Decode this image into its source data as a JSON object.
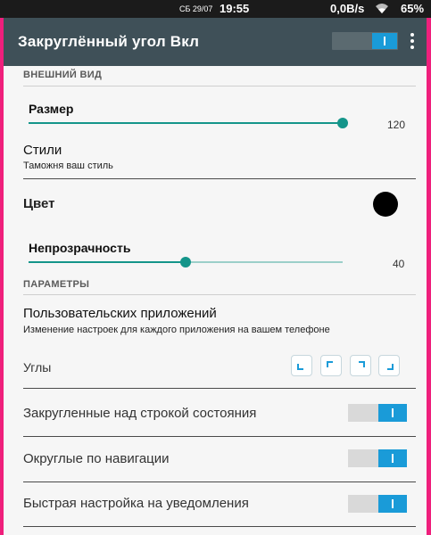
{
  "status_bar": {
    "date": "СБ 29/07",
    "time": "19:55",
    "network_speed": "0,0B/s",
    "battery": "65"
  },
  "toolbar": {
    "title": "Закруглённый угол Вкл",
    "main_switch_on": true
  },
  "appearance": {
    "header": "ВНЕШНИЙ ВИД",
    "size": {
      "label": "Размер",
      "value": "120",
      "fraction": 0.99
    },
    "styles": {
      "title": "Стили",
      "summary": "Таможня ваш стиль"
    },
    "color": {
      "label": "Цвет",
      "value": "#000000"
    },
    "opacity": {
      "label": "Непрозрачность",
      "value": "40",
      "fraction": 0.39
    }
  },
  "parameters": {
    "header": "ПАРАМЕТРЫ",
    "user_apps": {
      "title": "Пользовательских приложений",
      "summary": "Изменение настроек для каждого приложения на вашем телефоне"
    },
    "corners": {
      "label": "Углы"
    }
  },
  "toggles": [
    {
      "label": "Закругленные над строкой состояния",
      "on": true
    },
    {
      "label": "Округлые по навигации",
      "on": true
    },
    {
      "label": "Быстрая настройка на уведомления",
      "on": true
    }
  ],
  "colors": {
    "accent": "#14958a",
    "switch_on": "#1a9bd8",
    "toolbar": "#3f5058",
    "frame": "#ef1f7c"
  }
}
